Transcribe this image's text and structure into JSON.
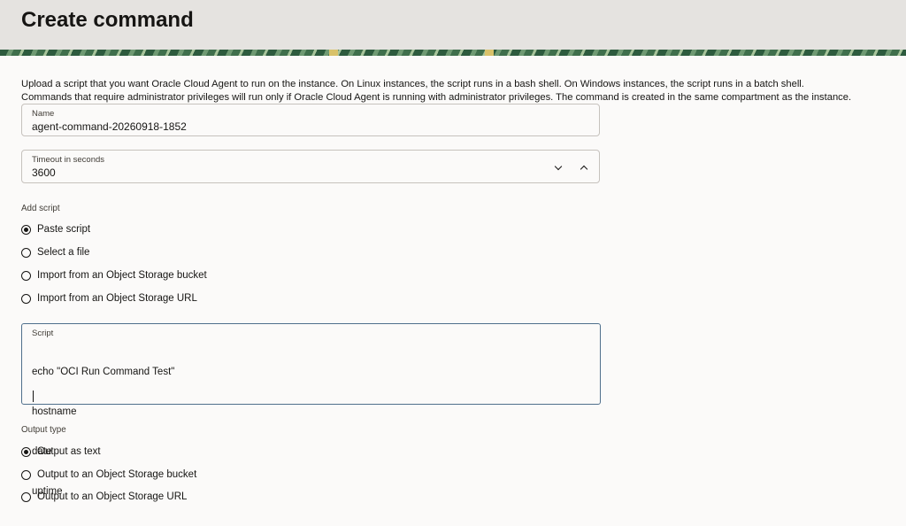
{
  "page": {
    "title": "Create command",
    "description_line1": "Upload a script that you want Oracle Cloud Agent to run on the instance. On Linux instances, the script runs in a bash shell. On Windows instances, the script runs in a batch shell.",
    "description_line2": "Commands that require administrator privileges will run only if Oracle Cloud Agent is running with administrator privileges. The command is created in the same compartment as the instance."
  },
  "name_field": {
    "label": "Name",
    "value": "agent-command-20260918-1852"
  },
  "timeout_field": {
    "label": "Timeout in seconds",
    "value": "3600",
    "decrement_icon": "chevron-down-icon",
    "increment_icon": "chevron-up-icon"
  },
  "add_script": {
    "label": "Add script",
    "options": [
      {
        "label": "Paste script",
        "selected": true
      },
      {
        "label": "Select a file",
        "selected": false
      },
      {
        "label": "Import from an Object Storage bucket",
        "selected": false
      },
      {
        "label": "Import from an Object Storage URL",
        "selected": false
      }
    ]
  },
  "script_field": {
    "label": "Script",
    "lines": [
      "echo \"OCI Run Command Test\"",
      "hostname",
      "date",
      "uptime"
    ]
  },
  "output_type": {
    "label": "Output type",
    "options": [
      {
        "label": "Output as text",
        "selected": true
      },
      {
        "label": "Output to an Object Storage bucket",
        "selected": false
      },
      {
        "label": "Output to an Object Storage URL",
        "selected": false
      }
    ]
  },
  "colors": {
    "header_bg": "#e5e3e0",
    "focus_border": "#4f6f8c",
    "text": "#161513"
  }
}
